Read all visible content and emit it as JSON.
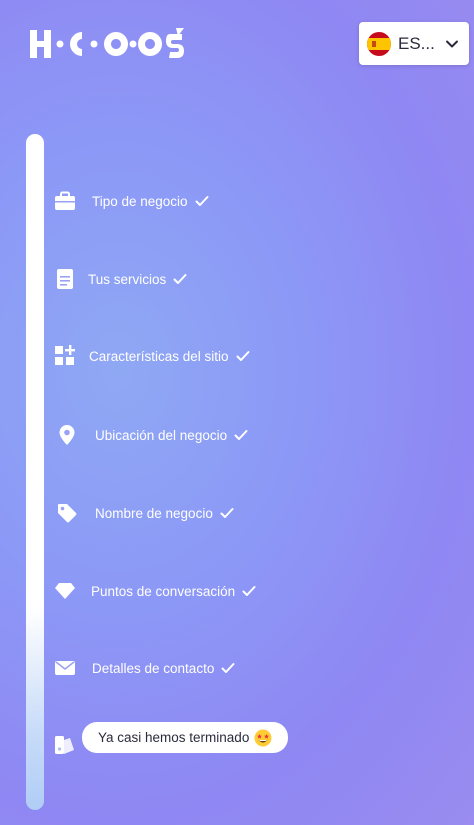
{
  "brand": {
    "name": "HOCOOS"
  },
  "language": {
    "code": "ES...",
    "flag": "spain-flag-icon"
  },
  "colors": {
    "accent": "#8c99f6",
    "text_dark": "#2b2b3e"
  },
  "steps": [
    {
      "label": "Tipo de negocio",
      "icon": "briefcase-icon",
      "done": true
    },
    {
      "label": "Tus servicios",
      "icon": "document-icon",
      "done": true
    },
    {
      "label": "Características del sitio",
      "icon": "widgets-icon",
      "done": true
    },
    {
      "label": "Ubicación del negocio",
      "icon": "location-pin-icon",
      "done": true
    },
    {
      "label": "Nombre de negocio",
      "icon": "tag-icon",
      "done": true
    },
    {
      "label": "Puntos de conversación",
      "icon": "diamond-icon",
      "done": true
    },
    {
      "label": "Detalles de contacto",
      "icon": "envelope-icon",
      "done": true
    },
    {
      "label": "Ya casi hemos terminado",
      "icon": "palette-icon",
      "done": false
    }
  ],
  "bubble": {
    "emoji": "star-struck-emoji-icon"
  }
}
